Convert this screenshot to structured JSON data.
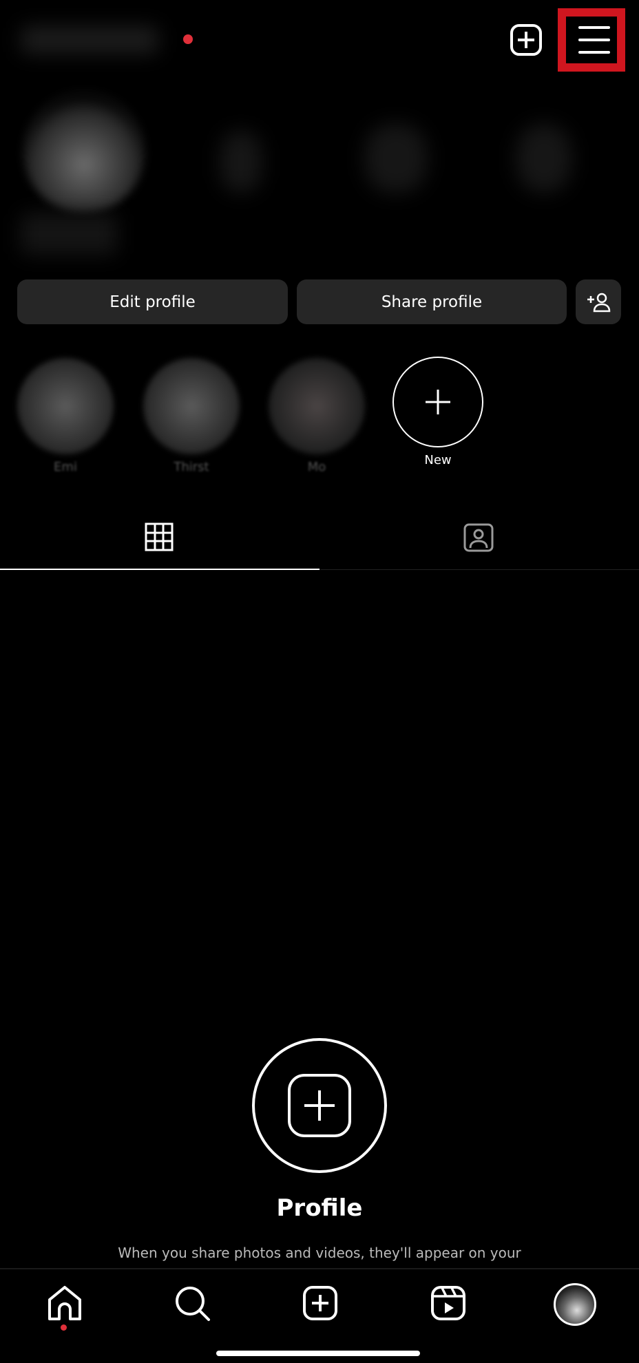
{
  "header": {
    "notification_color": "#e0303a",
    "highlight_box_color": "#d0161f",
    "icons": [
      "create-plus-icon",
      "menu-hamburger-icon"
    ]
  },
  "profile": {
    "edit_label": "Edit profile",
    "share_label": "Share profile",
    "add_person_icon": "person-add-icon"
  },
  "highlights": [
    {
      "label": "Emi"
    },
    {
      "label": "Thirst"
    },
    {
      "label": "Mo"
    },
    {
      "label": "New"
    }
  ],
  "tabs": [
    {
      "icon": "grid-icon",
      "active": true
    },
    {
      "icon": "tagged-person-icon",
      "active": false
    }
  ],
  "empty_state": {
    "title": "Profile",
    "text": "When you share photos and videos, they'll appear on your"
  },
  "bottom_nav": [
    {
      "icon": "home-icon",
      "active": true
    },
    {
      "icon": "search-icon"
    },
    {
      "icon": "create-icon"
    },
    {
      "icon": "reels-icon"
    },
    {
      "icon": "profile-avatar"
    }
  ]
}
